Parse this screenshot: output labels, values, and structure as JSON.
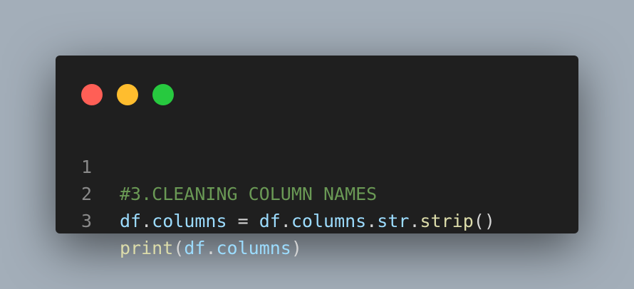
{
  "window": {
    "controls": [
      {
        "name": "close",
        "color": "#ff5f56"
      },
      {
        "name": "minimize",
        "color": "#ffbd2e"
      },
      {
        "name": "maximize",
        "color": "#27c93f"
      }
    ]
  },
  "code": {
    "language": "python",
    "lines": [
      {
        "number": "1",
        "tokens": [
          {
            "text": "#3.CLEANING COLUMN NAMES",
            "kind": "comment"
          }
        ]
      },
      {
        "number": "2",
        "tokens": [
          {
            "text": "df",
            "kind": "var"
          },
          {
            "text": ".",
            "kind": "punc"
          },
          {
            "text": "columns",
            "kind": "var"
          },
          {
            "text": " = ",
            "kind": "punc"
          },
          {
            "text": "df",
            "kind": "var"
          },
          {
            "text": ".",
            "kind": "punc"
          },
          {
            "text": "columns",
            "kind": "var"
          },
          {
            "text": ".",
            "kind": "punc"
          },
          {
            "text": "str",
            "kind": "var"
          },
          {
            "text": ".",
            "kind": "punc"
          },
          {
            "text": "strip",
            "kind": "fn"
          },
          {
            "text": "()",
            "kind": "punc"
          }
        ]
      },
      {
        "number": "3",
        "tokens": [
          {
            "text": "print",
            "kind": "fn"
          },
          {
            "text": "(",
            "kind": "punc"
          },
          {
            "text": "df",
            "kind": "var"
          },
          {
            "text": ".",
            "kind": "punc"
          },
          {
            "text": "columns",
            "kind": "var"
          },
          {
            "text": ")",
            "kind": "punc"
          }
        ]
      }
    ]
  }
}
